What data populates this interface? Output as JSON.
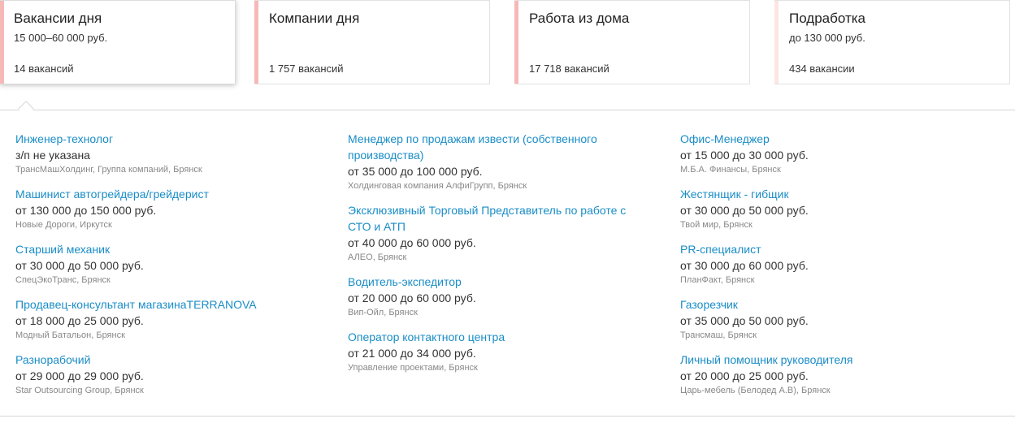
{
  "tabs": [
    {
      "title": "Вакансии дня",
      "subtitle": "15 000–60 000 руб.",
      "count": "14 вакансий",
      "stripe_color": "#f7b8b8",
      "active": true
    },
    {
      "title": "Компании дня",
      "subtitle": "",
      "count": "1 757 вакансий",
      "stripe_color": "#f7b8b8",
      "active": false
    },
    {
      "title": "Работа из дома",
      "subtitle": "",
      "count": "17 718 вакансий",
      "stripe_color": "#f7b8b8",
      "active": false
    },
    {
      "title": "Подработка",
      "subtitle": "до 130 000 руб.",
      "count": "434 вакансии",
      "stripe_color": "#fde6e0",
      "active": false
    }
  ],
  "vacancies": {
    "col1": [
      {
        "title": "Инженер-технолог",
        "salary": "з/п не указана",
        "company": "ТрансМашХолдинг, Группа компаний, Брянск"
      },
      {
        "title": "Машинист автогрейдера/грейдерист",
        "salary": "от 130 000 до 150 000 руб.",
        "company": "Новые Дороги, Иркутск"
      },
      {
        "title": "Старший механик",
        "salary": "от 30 000 до 50 000 руб.",
        "company": "СпецЭкоТранс, Брянск"
      },
      {
        "title": "Продавец-консультант магазинаTERRANOVA",
        "salary": "от 18 000 до 25 000 руб.",
        "company": "Модный Батальон, Брянск"
      },
      {
        "title": "Разнорабочий",
        "salary": "от 29 000 до 29 000 руб.",
        "company": "Star Outsourcing Group, Брянск"
      }
    ],
    "col2": [
      {
        "title_line1": "Менеджер по продажам извести (собственного",
        "title_line2": "производства)",
        "salary": "от 35 000 до 100 000 руб.",
        "company": "Холдинговая компания АлфиГрупп, Брянск"
      },
      {
        "title_line1": "Эксклюзивный Торговый Представитель по работе с",
        "title_line2": "СТО и АТП",
        "salary": "от 40 000 до 60 000 руб.",
        "company": "АЛЕО, Брянск"
      },
      {
        "title": "Водитель-экспедитор",
        "salary": "от 20 000 до 60 000 руб.",
        "company": "Вип-Ойл, Брянск"
      },
      {
        "title": "Оператор контактного центра",
        "salary": "от 21 000 до 34 000 руб.",
        "company": "Управление проектами, Брянск"
      }
    ],
    "col3": [
      {
        "title": "Офис-Менеджер",
        "salary": "от 15 000 до 30 000 руб.",
        "company": "М.Б.А. Финансы, Брянск"
      },
      {
        "title": "Жестянщик - гибщик",
        "salary": "от 30 000 до 50 000 руб.",
        "company": "Твой мир, Брянск"
      },
      {
        "title": "PR-специалист",
        "salary": "от 30 000 до 60 000 руб.",
        "company": "ПланФакт, Брянск"
      },
      {
        "title": "Газорезчик",
        "salary": "от 35 000 до 50 000 руб.",
        "company": "Трансмаш, Брянск"
      },
      {
        "title": "Личный помощник руководителя",
        "salary": "от 20 000 до 25 000 руб.",
        "company": "Царь-мебель (Белодед А.В), Брянск"
      }
    ]
  },
  "colors": {
    "link": "#1a8dc7",
    "text": "#333333",
    "muted": "#888888"
  }
}
